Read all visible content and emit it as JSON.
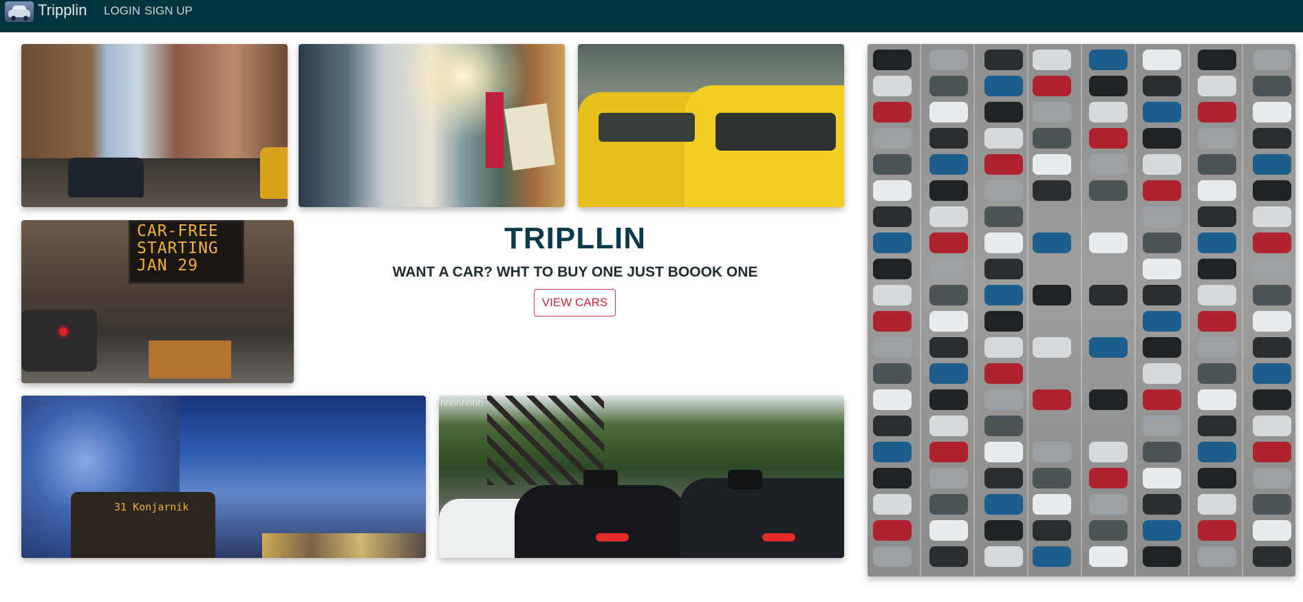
{
  "navbar": {
    "brand": "Tripplin",
    "links": [
      {
        "label": "LOGIN"
      },
      {
        "label": "SIGN UP"
      }
    ],
    "background_color": "#023440"
  },
  "hero": {
    "title": "TRIPLLIN",
    "subtitle": "WANT A CAR? WHT TO BUY ONE JUST BOOOK ONE",
    "cta_label": "VIEW CARS",
    "accent_color": "#c2283c"
  },
  "gallery": {
    "carfree_sign_text": "CAR-FREE STARTING JAN 29",
    "bus_sign_text": "31 Konjarnik",
    "fleet_watermark": "hhhhhhhh"
  }
}
